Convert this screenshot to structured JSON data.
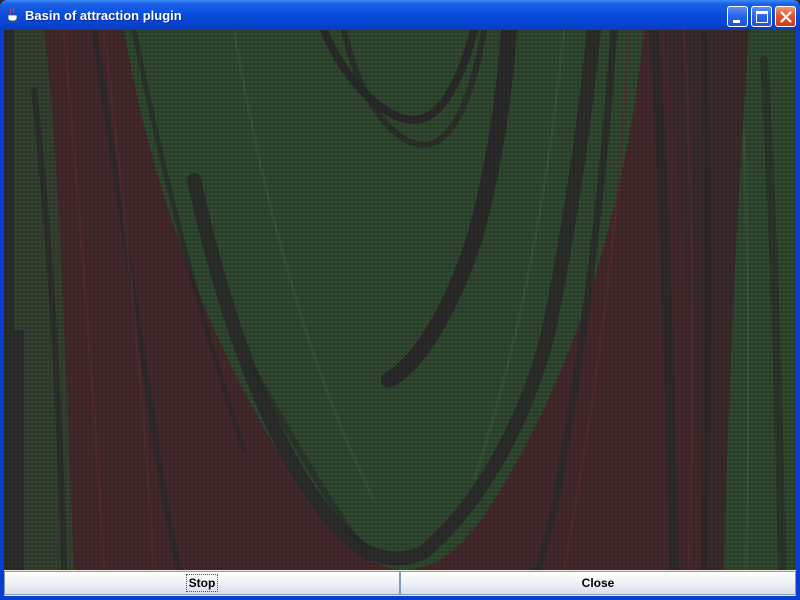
{
  "window": {
    "title": "Basin of attraction plugin",
    "controls": [
      "minimize",
      "maximize",
      "close"
    ]
  },
  "canvas": {
    "description_icon": "basin-plot",
    "colors": {
      "green_basin": "#2f4a2f",
      "red_basin": "#4a2a2a",
      "dark_curve": "#2b2b2b"
    }
  },
  "buttons": {
    "stop": "Stop",
    "close": "Close"
  }
}
